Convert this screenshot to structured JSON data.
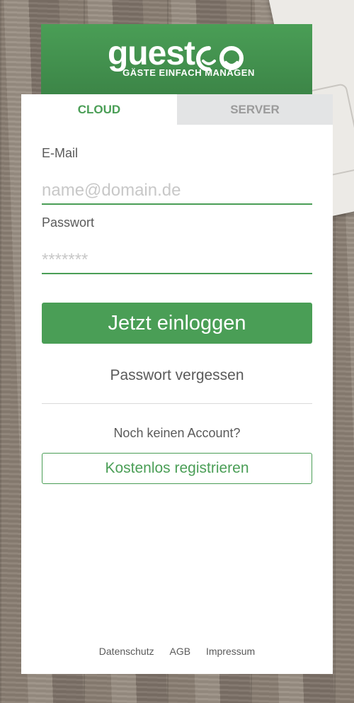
{
  "brand": {
    "name": "guest",
    "tagline": "GÄSTE EINFACH MANAGEN"
  },
  "tabs": [
    {
      "label": "CLOUD",
      "active": true
    },
    {
      "label": "SERVER",
      "active": false
    }
  ],
  "form": {
    "email_label": "E-Mail",
    "email_placeholder": "name@domain.de",
    "password_label": "Passwort",
    "password_placeholder": "*******",
    "login_button": "Jetzt einloggen",
    "forgot_link": "Passwort vergessen"
  },
  "register": {
    "prompt": "Noch keinen Account?",
    "button": "Kostenlos registrieren"
  },
  "footer": {
    "links": [
      "Datenschutz",
      "AGB",
      "Impressum"
    ]
  },
  "colors": {
    "accent": "#4a9e56",
    "inactive_tab_bg": "#e3e4e5",
    "text": "#5a5a5a"
  }
}
